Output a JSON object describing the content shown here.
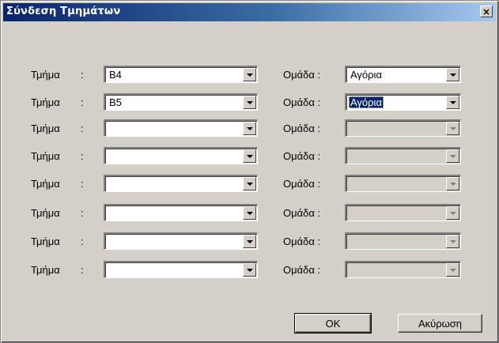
{
  "window": {
    "title": "Σύνδεση Τμημάτων",
    "close_glyph": "×"
  },
  "labels": {
    "tmima": "Τμήμα",
    "colon": ":",
    "omada": "Ομάδα :"
  },
  "rows": [
    {
      "tmima_value": "B4",
      "omada_value": "Αγόρια",
      "omada_enabled": true,
      "omada_selected": false
    },
    {
      "tmima_value": "B5",
      "omada_value": "Αγόρια",
      "omada_enabled": true,
      "omada_selected": true
    },
    {
      "tmima_value": "",
      "omada_value": "",
      "omada_enabled": false,
      "omada_selected": false
    },
    {
      "tmima_value": "",
      "omada_value": "",
      "omada_enabled": false,
      "omada_selected": false
    },
    {
      "tmima_value": "",
      "omada_value": "",
      "omada_enabled": false,
      "omada_selected": false
    },
    {
      "tmima_value": "",
      "omada_value": "",
      "omada_enabled": false,
      "omada_selected": false
    },
    {
      "tmima_value": "",
      "omada_value": "",
      "omada_enabled": false,
      "omada_selected": false
    },
    {
      "tmima_value": "",
      "omada_value": "",
      "omada_enabled": false,
      "omada_selected": false
    }
  ],
  "buttons": {
    "ok": "OK",
    "cancel": "Ακύρωση"
  }
}
